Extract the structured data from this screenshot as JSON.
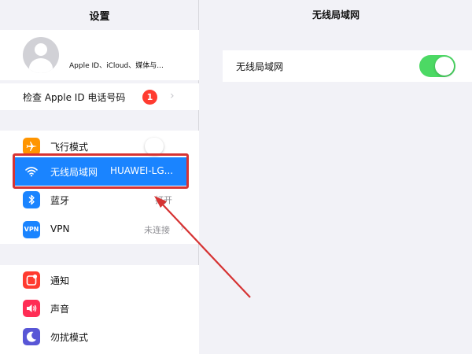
{
  "sidebar": {
    "title": "设置",
    "profile": {
      "subtitle": "Apple ID、iCloud、媒体与..."
    },
    "apple_id_check": {
      "label": "检查 Apple ID 电话号码",
      "badge": "1"
    },
    "items": [
      {
        "label": "飞行模式",
        "icon": "airplane-icon",
        "color": "#ff9500",
        "toggle": "off"
      },
      {
        "label": "无线局域网",
        "value": "HUAWEI-LG...",
        "icon": "wifi-icon",
        "color": "#1a84ff",
        "selected": true
      },
      {
        "label": "蓝牙",
        "value": "打开",
        "icon": "bluetooth-icon",
        "color": "#1a84ff"
      },
      {
        "label": "VPN",
        "value": "未连接",
        "icon": "vpn-icon",
        "color": "#1a84ff",
        "icon_text": "VPN"
      },
      {
        "label": "通知",
        "icon": "notification-icon",
        "color": "#ff3b30"
      },
      {
        "label": "声音",
        "icon": "sound-icon",
        "color": "#ff2d55"
      },
      {
        "label": "勿扰模式",
        "icon": "moon-icon",
        "color": "#5856d6"
      }
    ]
  },
  "detail": {
    "title": "无线局域网",
    "wifi_toggle": {
      "label": "无线局域网",
      "state": "on",
      "color": "#4cd964"
    }
  },
  "annotation": {
    "highlight_color": "#d63333"
  }
}
